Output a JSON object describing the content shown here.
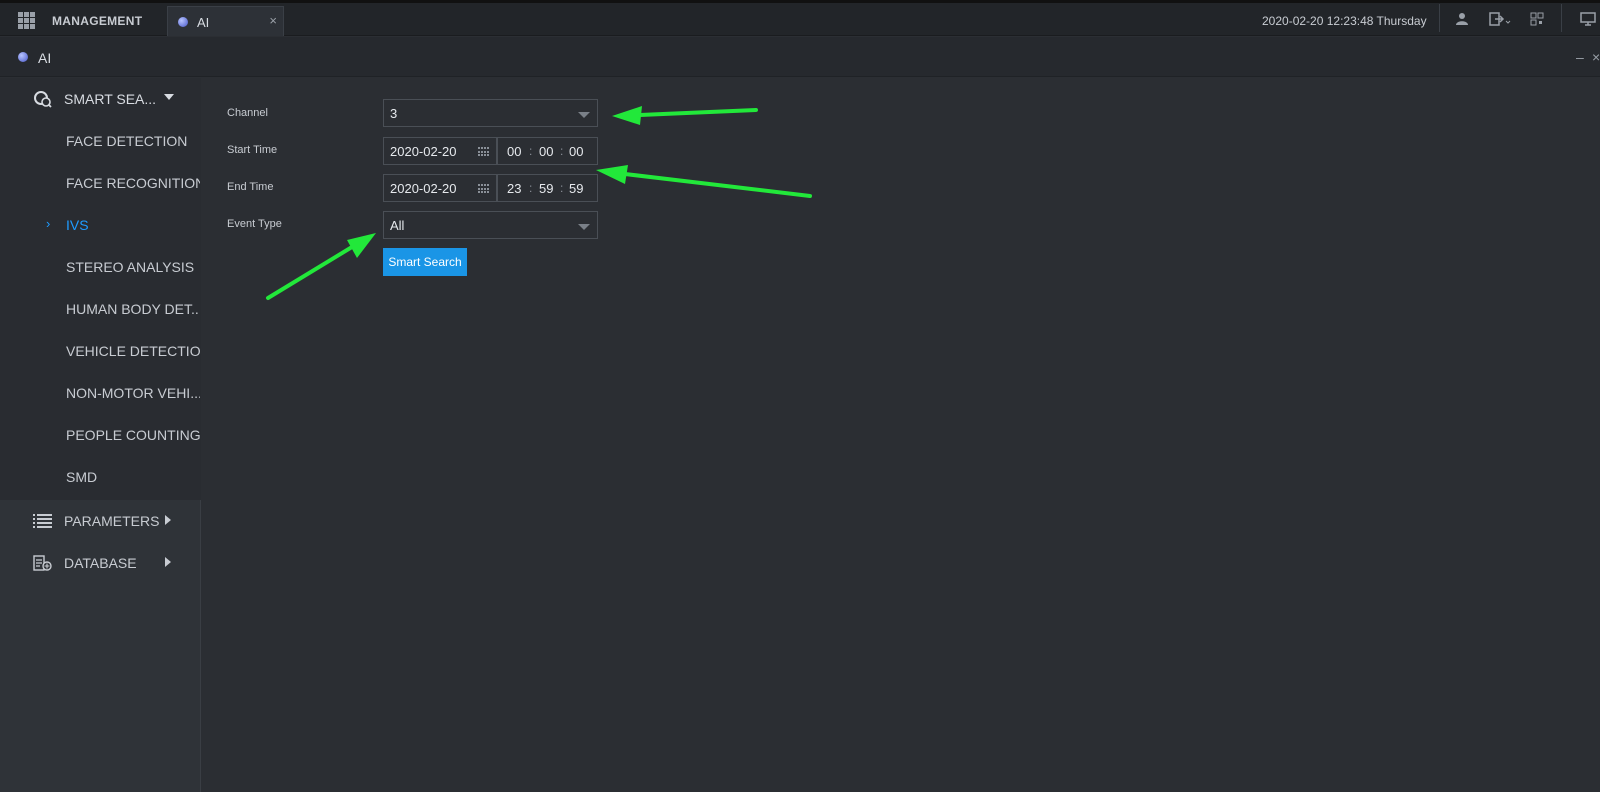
{
  "topbar": {
    "management_label": "MANAGEMENT",
    "tab_label": "AI",
    "tab_close": "×",
    "datetime": "2020-02-20 12:23:48 Thursday"
  },
  "subheader": {
    "title": "AI",
    "minimize": "–",
    "close": "×"
  },
  "sidebar": {
    "smart_search": "SMART SEA...",
    "items": [
      {
        "label": "FACE DETECTION"
      },
      {
        "label": "FACE RECOGNITION"
      },
      {
        "label": "IVS",
        "active": true
      },
      {
        "label": "STEREO ANALYSIS"
      },
      {
        "label": "HUMAN BODY DET..."
      },
      {
        "label": "VEHICLE DETECTION"
      },
      {
        "label": "NON-MOTOR VEHI..."
      },
      {
        "label": "PEOPLE COUNTING"
      },
      {
        "label": "SMD"
      }
    ],
    "active_chevron": "›",
    "parameters": "PARAMETERS",
    "database": "DATABASE"
  },
  "form": {
    "channel_label": "Channel",
    "channel_value": "3",
    "start_label": "Start Time",
    "start_date": "2020-02-20",
    "start_h": "00",
    "start_m": "00",
    "start_s": "00",
    "end_label": "End Time",
    "end_date": "2020-02-20",
    "end_h": "23",
    "end_m": "59",
    "end_s": "59",
    "time_sep": ":",
    "event_label": "Event Type",
    "event_value": "All",
    "search_button": "Smart Search"
  },
  "colors": {
    "accent": "#1e9bff",
    "button": "#1a95e6",
    "annotation_arrow": "#22e83a"
  }
}
